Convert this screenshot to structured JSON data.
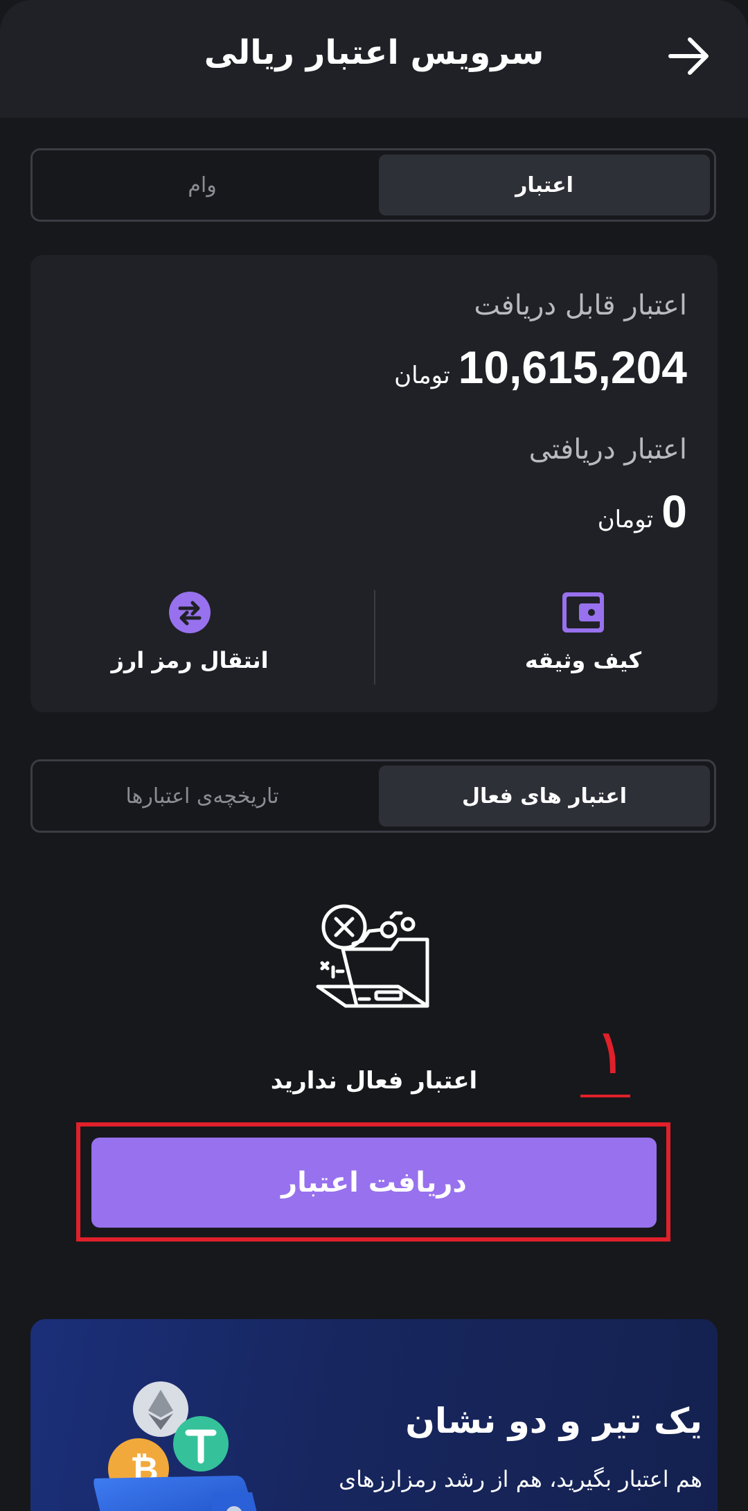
{
  "header": {
    "title": "سرویس اعتبار ریالی",
    "back_icon": "arrow-right-icon"
  },
  "top_tabs": {
    "active": "اعتبار",
    "inactive": "وام"
  },
  "credit_card": {
    "available_label": "اعتبار قابل دریافت",
    "available_amount": "10,615,204",
    "available_unit": "تومان",
    "received_label": "اعتبار دریافتی",
    "received_amount": "0",
    "received_unit": "تومان",
    "actions": [
      {
        "label": "کیف وثیقه",
        "icon": "wallet-icon"
      },
      {
        "label": "انتقال رمز ارز",
        "icon": "transfer-icon"
      }
    ]
  },
  "list_tabs": {
    "active": "اعتبار های فعال",
    "inactive": "تاریخچه‌ی اعتبارها"
  },
  "empty_state": {
    "icon": "empty-folder-icon",
    "text": "اعتبار فعال ندارید"
  },
  "primary_button": {
    "label": "دریافت اعتبار"
  },
  "annotation": {
    "number": "۱",
    "color": "#e0202a"
  },
  "banner": {
    "title": "یک تیر و دو نشان",
    "subtitle": "هم اعتبار بگیرید، هم از رشد رمزارزهای"
  },
  "colors": {
    "accent": "#9871ee",
    "background": "#17181c",
    "surface": "#1f2126"
  }
}
